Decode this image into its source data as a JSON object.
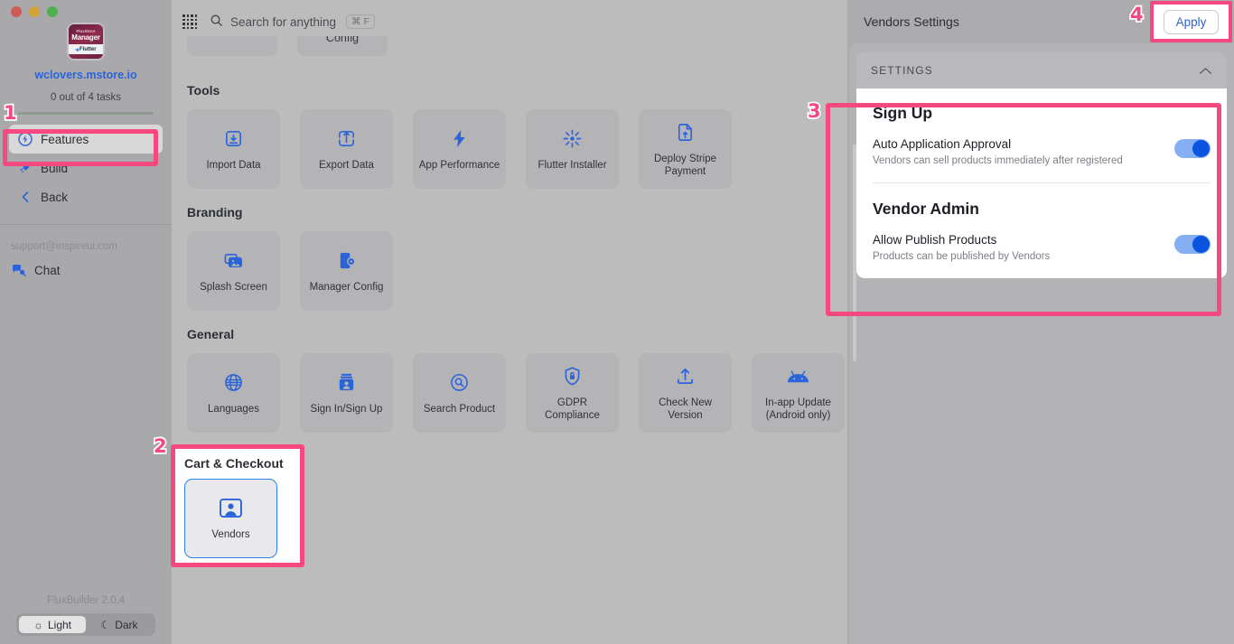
{
  "window": {
    "traffic_lights": [
      "close",
      "minimize",
      "maximize"
    ]
  },
  "sidebar": {
    "app_icon": {
      "line1": "FluxStore",
      "line2": "Manager",
      "flutter_label": "Flutter"
    },
    "site_name": "wclovers.mstore.io",
    "tasks_text": "0 out of 4 tasks",
    "nav_items": [
      {
        "label": "Features",
        "icon": "feature-circle-icon",
        "active": true
      },
      {
        "label": "Build",
        "icon": "rocket-icon",
        "active": false
      },
      {
        "label": "Back",
        "icon": "chevron-left-icon",
        "active": false
      }
    ],
    "support_email": "support@inspireui.com",
    "chat_label": "Chat",
    "version": "FluxBuilder 2.0.4",
    "theme": {
      "light_label": "Light",
      "dark_label": "Dark",
      "selected": "Light"
    }
  },
  "topbar": {
    "grid_icon": "apps-grid-icon",
    "search_placeholder": "Search for anything",
    "search_shortcut": "⌘ F"
  },
  "main": {
    "cut_cards": [
      "",
      "Config"
    ],
    "sections": [
      {
        "title": "Tools",
        "cards": [
          {
            "label": "Import Data",
            "icon": "import-icon"
          },
          {
            "label": "Export Data",
            "icon": "export-icon"
          },
          {
            "label": "App Performance",
            "icon": "bolt-icon"
          },
          {
            "label": "Flutter Installer",
            "icon": "sparkle-icon"
          },
          {
            "label": "Deploy Stripe Payment",
            "icon": "file-upload-icon"
          }
        ]
      },
      {
        "title": "Branding",
        "cards": [
          {
            "label": "Splash Screen",
            "icon": "images-icon"
          },
          {
            "label": "Manager Config",
            "icon": "phone-gear-icon"
          }
        ]
      },
      {
        "title": "General",
        "cards": [
          {
            "label": "Languages",
            "icon": "globe-icon"
          },
          {
            "label": "Sign In/Sign Up",
            "icon": "id-card-icon"
          },
          {
            "label": "Search Product",
            "icon": "search-circle-icon"
          },
          {
            "label": "GDPR Compliance",
            "icon": "shield-lock-icon"
          },
          {
            "label": "Check New Version",
            "icon": "upload-icon"
          },
          {
            "label": "In-app Update (Android only)",
            "icon": "android-icon"
          }
        ]
      }
    ],
    "cart_section": {
      "title": "Cart & Checkout",
      "cards": [
        {
          "label": "Vendors",
          "icon": "vendor-person-icon",
          "selected": true
        }
      ]
    }
  },
  "right_panel": {
    "title": "Vendors Settings",
    "apply_label": "Apply",
    "settings_header": "SETTINGS",
    "collapse_icon": "chevron-up-icon",
    "groups": [
      {
        "title": "Sign Up",
        "rows": [
          {
            "label": "Auto Application Approval",
            "description": "Vendors can sell products immediately after registered",
            "toggle_on": true
          }
        ]
      },
      {
        "title": "Vendor Admin",
        "rows": [
          {
            "label": "Allow Publish Products",
            "description": "Products can be published by Vendors",
            "toggle_on": true
          }
        ]
      }
    ]
  },
  "annotations": {
    "badge1": "1",
    "badge2": "2",
    "badge3": "3",
    "badge4": "4",
    "highlight_color": "#f5497f"
  }
}
